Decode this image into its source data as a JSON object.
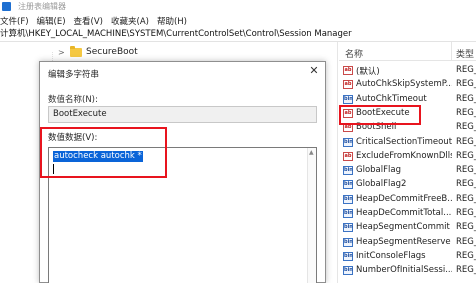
{
  "window": {
    "title": "注册表编辑器"
  },
  "menu": {
    "items": [
      "文件(F)",
      "编辑(E)",
      "查看(V)",
      "收藏夹(A)",
      "帮助(H)"
    ]
  },
  "address": {
    "path": "计算机\\HKEY_LOCAL_MACHINE\\SYSTEM\\CurrentControlSet\\Control\\Session Manager"
  },
  "tree": {
    "item": {
      "chevron": ">",
      "label": "SecureBoot"
    }
  },
  "values_pane": {
    "col_name": "名称",
    "col_type": "类型",
    "rows": [
      {
        "name": "(默认)",
        "type": "REG_",
        "icon": "ab"
      },
      {
        "name": "AutoChkSkipSystemP...",
        "type": "REG_",
        "icon": "ab"
      },
      {
        "name": "AutoChkTimeout",
        "type": "REG_",
        "icon": "bin"
      },
      {
        "name": "BootExecute",
        "type": "REG_",
        "icon": "ab"
      },
      {
        "name": "BootShell",
        "type": "REG_",
        "icon": "ab"
      },
      {
        "name": "CriticalSectionTimeout",
        "type": "REG_",
        "icon": "bin"
      },
      {
        "name": "ExcludeFromKnownDlls",
        "type": "REG_",
        "icon": "ab"
      },
      {
        "name": "GlobalFlag",
        "type": "REG_",
        "icon": "bin"
      },
      {
        "name": "GlobalFlag2",
        "type": "REG_",
        "icon": "bin"
      },
      {
        "name": "HeapDeCommitFreeB...",
        "type": "REG_",
        "icon": "bin"
      },
      {
        "name": "HeapDeCommitTotal...",
        "type": "REG_",
        "icon": "bin"
      },
      {
        "name": "HeapSegmentCommit",
        "type": "REG_",
        "icon": "bin"
      },
      {
        "name": "HeapSegmentReserve",
        "type": "REG_",
        "icon": "bin"
      },
      {
        "name": "InitConsoleFlags",
        "type": "REG_",
        "icon": "bin"
      },
      {
        "name": "NumberOfInitialSessi...",
        "type": "REG_",
        "icon": "bin"
      }
    ]
  },
  "dialog": {
    "title": "编辑多字符串",
    "close_glyph": "✕",
    "name_label": "数值名称(N):",
    "name_value": "BootExecute",
    "data_label": "数值数据(V):",
    "data_value": "autocheck autochk *",
    "scroll_up_glyph": "▲"
  },
  "colors": {
    "annotation_red": "#e8141e",
    "selection_blue": "#0a64d8"
  }
}
